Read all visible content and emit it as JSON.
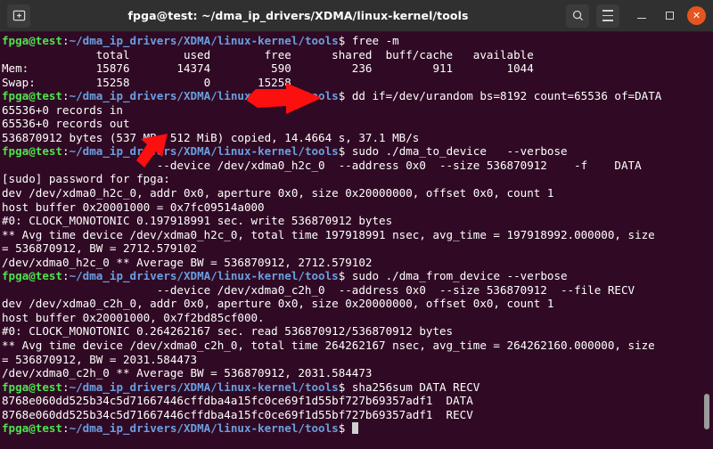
{
  "window": {
    "title": "fpga@test: ~/dma_ip_drivers/XDMA/linux-kernel/tools",
    "background_color": "#300a24",
    "titlebar_color": "#303030",
    "close_button_color": "#e6551e"
  },
  "titlebar": {
    "new_tab_icon": "new-tab-icon",
    "search_icon": "search-icon",
    "menu_icon": "hamburger-menu-icon",
    "minimize_icon": "minimize-icon",
    "maximize_icon": "maximize-icon",
    "close_icon": "close-icon",
    "close_glyph": "✕"
  },
  "terminal": {
    "prompt": {
      "user_host": "fpga@test",
      "colon": ":",
      "path": "~/dma_ip_drivers/XDMA/linux-kernel/tools",
      "sigil": "$",
      "user_host_color": "#4ee24e",
      "path_color": "#6a9fe0"
    },
    "lines": [
      {
        "type": "prompt",
        "command": " free -m"
      },
      {
        "type": "out",
        "text": "              total        used        free      shared  buff/cache   available"
      },
      {
        "type": "out",
        "text": "Mem:          15876       14374         590         236         911        1044"
      },
      {
        "type": "out",
        "text": "Swap:         15258           0       15258"
      },
      {
        "type": "prompt",
        "command": " dd if=/dev/urandom bs=8192 count=65536 of=DATA"
      },
      {
        "type": "out",
        "text": "65536+0 records in"
      },
      {
        "type": "out",
        "text": "65536+0 records out"
      },
      {
        "type": "out",
        "text": "536870912 bytes (537 MB, 512 MiB) copied, 14.4664 s, 37.1 MB/s"
      },
      {
        "type": "prompt",
        "command": " sudo ./dma_to_device   --verbose"
      },
      {
        "type": "out",
        "text": "                       --device /dev/xdma0_h2c_0  --address 0x0  --size 536870912    -f    DATA"
      },
      {
        "type": "out",
        "text": "[sudo] password for fpga:"
      },
      {
        "type": "out",
        "text": "dev /dev/xdma0_h2c_0, addr 0x0, aperture 0x0, size 0x20000000, offset 0x0, count 1"
      },
      {
        "type": "out",
        "text": "host buffer 0x20001000 = 0x7fc09514a000"
      },
      {
        "type": "out",
        "text": "#0: CLOCK_MONOTONIC 0.197918991 sec. write 536870912 bytes"
      },
      {
        "type": "out",
        "text": "** Avg time device /dev/xdma0_h2c_0, total time 197918991 nsec, avg_time = 197918992.000000, size"
      },
      {
        "type": "out",
        "text": "= 536870912, BW = 2712.579102"
      },
      {
        "type": "out",
        "text": "/dev/xdma0_h2c_0 ** Average BW = 536870912, 2712.579102"
      },
      {
        "type": "prompt",
        "command": " sudo ./dma_from_device --verbose"
      },
      {
        "type": "out",
        "text": "                       --device /dev/xdma0_c2h_0  --address 0x0  --size 536870912  --file RECV"
      },
      {
        "type": "out",
        "text": "dev /dev/xdma0_c2h_0, addr 0x0, aperture 0x0, size 0x20000000, offset 0x0, count 1"
      },
      {
        "type": "out",
        "text": "host buffer 0x20001000, 0x7f2bd85cf000."
      },
      {
        "type": "out",
        "text": "#0: CLOCK_MONOTONIC 0.264262167 sec. read 536870912/536870912 bytes"
      },
      {
        "type": "out",
        "text": "** Avg time device /dev/xdma0_c2h_0, total time 264262167 nsec, avg_time = 264262160.000000, size"
      },
      {
        "type": "out",
        "text": "= 536870912, BW = 2031.584473"
      },
      {
        "type": "out",
        "text": "/dev/xdma0_c2h_0 ** Average BW = 536870912, 2031.584473"
      },
      {
        "type": "prompt",
        "command": " sha256sum DATA RECV"
      },
      {
        "type": "out",
        "text": "8768e060dd525b34c5d71667446cffdba4a15fc0ce69f1d55bf727b69357adf1  DATA"
      },
      {
        "type": "out",
        "text": "8768e060dd525b34c5d71667446cffdba4a15fc0ce69f1d55bf727b69357adf1  RECV"
      },
      {
        "type": "prompt",
        "command": " ",
        "cursor": true
      }
    ]
  },
  "annotations": [
    {
      "name": "arrow-pointing-to-free-column",
      "color": "#fb0f0f",
      "direction": "right"
    },
    {
      "name": "arrow-pointing-to-records-out",
      "color": "#fb0f0f",
      "direction": "down-left"
    }
  ]
}
